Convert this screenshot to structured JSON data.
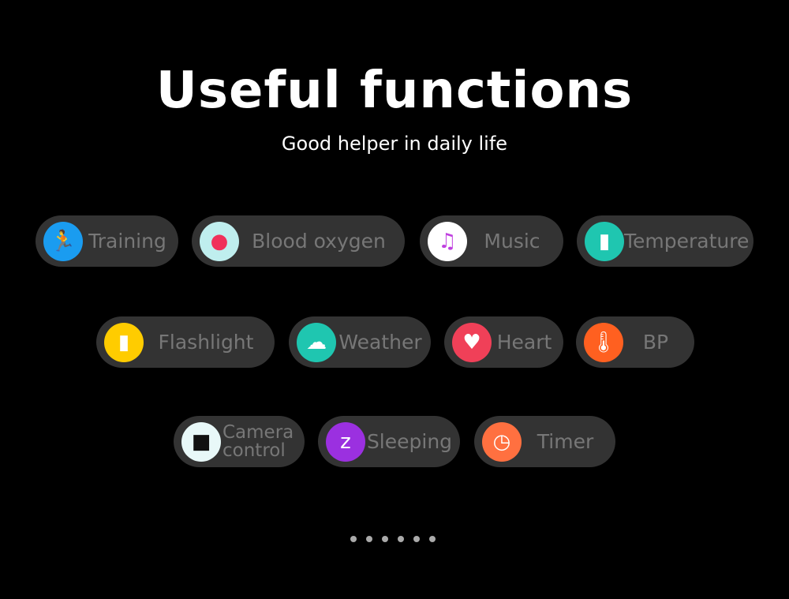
{
  "header": {
    "title": "Useful functions",
    "subtitle": "Good helper in daily life"
  },
  "functions": [
    {
      "label": "Training",
      "icon": "running-icon",
      "color": "#1a9cf0"
    },
    {
      "label": "Blood oxygen",
      "icon": "blood-drop-icon",
      "color": "#bfeeee"
    },
    {
      "label": "Music",
      "icon": "music-note-icon",
      "color": "#ffffff"
    },
    {
      "label": "Temperature",
      "icon": "thermometer-gun-icon",
      "color": "#1fc6b0"
    },
    {
      "label": "Flashlight",
      "icon": "flashlight-icon",
      "color": "#ffcc00"
    },
    {
      "label": "Weather",
      "icon": "cloud-sun-icon",
      "color": "#1fc6b0"
    },
    {
      "label": "Heart",
      "icon": "heart-rate-icon",
      "color": "#f04058"
    },
    {
      "label": "BP",
      "icon": "thermometer-icon",
      "color": "#ff6020"
    },
    {
      "label": "Camera control",
      "icon": "camera-icon",
      "color": "#e8f8f8"
    },
    {
      "label": "Sleeping",
      "icon": "sleep-icon",
      "color": "#9b30e0"
    },
    {
      "label": "Timer",
      "icon": "stopwatch-icon",
      "color": "#ff7040"
    }
  ],
  "pagination": {
    "count": 6
  }
}
